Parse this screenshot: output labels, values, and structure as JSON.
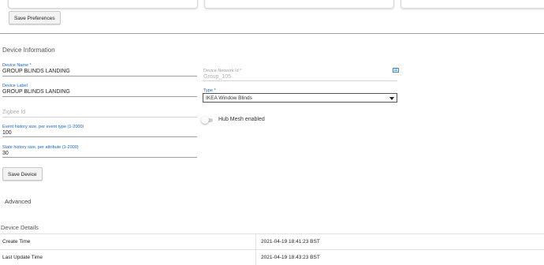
{
  "top": {
    "save_preferences_label": "Save Preferences"
  },
  "device_information": {
    "section_title": "Device Information",
    "device_name": {
      "label": "Device Name *",
      "value": "GROUP BLINDS LANDING"
    },
    "device_label": {
      "label": "Device Label",
      "value": "GROUP BLINDS LANDING"
    },
    "zigbee_id": {
      "placeholder": "Zigbee Id"
    },
    "event_history": {
      "label": "Event history size, per event type (1-2000)",
      "value": "100"
    },
    "state_history": {
      "label": "State history size, per attribute (1-2000)",
      "value": "30"
    },
    "device_network_id": {
      "label": "Device Network Id *",
      "value": "Group_105"
    },
    "edit_icon": "edit-icon",
    "type": {
      "label": "Type *",
      "selected": "IKEA Window Blinds"
    },
    "hub_mesh": {
      "label": "Hub Mesh enabled",
      "enabled": false
    },
    "save_device_label": "Save Device"
  },
  "advanced": {
    "label": "Advanced"
  },
  "device_details": {
    "section_title": "Device Details",
    "rows": [
      {
        "key": "Create Time",
        "value": "2021-04-19 18:41:23 BST"
      },
      {
        "key": "Last Update Time",
        "value": "2021-04-19 18:43:23 BST"
      }
    ]
  },
  "colors": {
    "accent_label": "#1565c0",
    "divider": "#9e9e9e"
  }
}
